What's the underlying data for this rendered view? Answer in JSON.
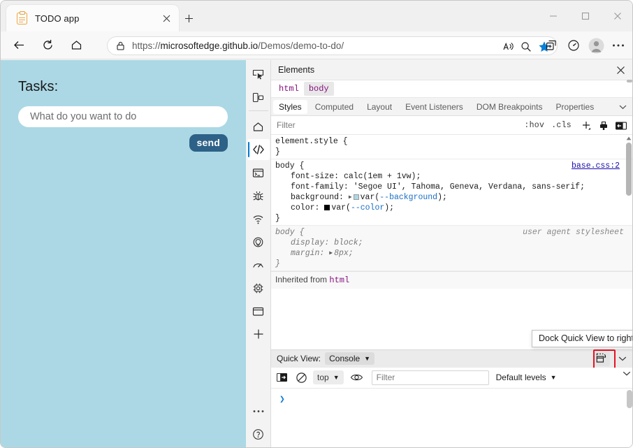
{
  "window": {
    "minimize_label": "Minimize",
    "maximize_label": "Maximize",
    "close_label": "Close"
  },
  "browser": {
    "tab": {
      "title": "TODO app",
      "favicon": "clipboard-icon",
      "close_label": "×"
    },
    "new_tab_label": "+",
    "nav": {
      "back": "back-arrow-icon",
      "refresh": "refresh-icon",
      "home": "home-icon"
    },
    "address": {
      "lock_icon": "lock-icon",
      "url_prefix": "https://",
      "url_host": "microsoftedge.github.io",
      "url_path": "/Demos/demo-to-do/",
      "url_full": "https://microsoftedge.github.io/Demos/demo-to-do/",
      "read_aloud_icon": "read-aloud-icon",
      "zoom_out_icon": "search-zoom-icon",
      "favorite_icon": "star-filled-icon"
    },
    "toolbar_right": [
      {
        "name": "collections-icon",
        "label": "Collections"
      },
      {
        "name": "performance-icon",
        "label": "Browser essentials"
      },
      {
        "name": "profile-avatar",
        "label": "Profile"
      },
      {
        "name": "settings-more-icon",
        "label": "Settings and more"
      }
    ]
  },
  "page": {
    "heading": "Tasks:",
    "input_placeholder": "What do you want to do",
    "input_value": "",
    "send_label": "send",
    "background_color": "#ACD8E5",
    "send_color": "#2e6187"
  },
  "devtools": {
    "rail": [
      {
        "name": "inspect-element-icon",
        "label": "Inspect"
      },
      {
        "name": "device-emulation-icon",
        "label": "Device emulation"
      },
      {
        "name": "welcome-home-icon",
        "label": "Welcome"
      },
      {
        "name": "elements-icon",
        "label": "Elements",
        "selected": true
      },
      {
        "name": "console-icon",
        "label": "Console"
      },
      {
        "name": "sources-debugger-icon",
        "label": "Sources"
      },
      {
        "name": "network-icon",
        "label": "Network"
      },
      {
        "name": "lighthouse-icon",
        "label": "Lighthouse"
      },
      {
        "name": "performance-gauge-icon",
        "label": "Performance"
      },
      {
        "name": "memory-chip-icon",
        "label": "Memory"
      },
      {
        "name": "application-window-icon",
        "label": "Application"
      },
      {
        "name": "more-tools-plus-icon",
        "label": "More tools"
      }
    ],
    "rail_bottom": [
      {
        "name": "more-options-icon",
        "label": "Customize and control DevTools"
      },
      {
        "name": "help-icon",
        "label": "Help"
      }
    ],
    "panel_title": "Elements",
    "panel_close_label": "×",
    "breadcrumb": [
      {
        "label": "html",
        "selected": false
      },
      {
        "label": "body",
        "selected": true
      }
    ],
    "styles_tabs": [
      {
        "label": "Styles",
        "selected": true
      },
      {
        "label": "Computed",
        "selected": false
      },
      {
        "label": "Layout",
        "selected": false
      },
      {
        "label": "Event Listeners",
        "selected": false
      },
      {
        "label": "DOM Breakpoints",
        "selected": false
      },
      {
        "label": "Properties",
        "selected": false
      }
    ],
    "styles_tabs_more_icon": "chevron-down-icon",
    "filter": {
      "placeholder": "Filter",
      "value": "",
      "hov_label": ":hov",
      "cls_label": ".cls",
      "new_rule_icon": "plus-icon",
      "element_state_icon": "print-style-icon",
      "sidebar_toggle_icon": "toggle-sidebar-icon"
    },
    "rules": [
      {
        "selector": "element.style {",
        "close": "}",
        "source": "",
        "declarations": []
      },
      {
        "selector": "body {",
        "close": "}",
        "source": "base.css:2",
        "declarations": [
          {
            "prop": "font-size",
            "value": "calc(1em + 1vw);"
          },
          {
            "prop": "font-family",
            "value": "'Segoe UI', Tahoma, Geneva, Verdana, sans-serif;"
          },
          {
            "prop": "background",
            "value": "var(--background);",
            "swatch": "#ACD8E5",
            "expandable": true
          },
          {
            "prop": "color",
            "value": "var(--color);",
            "swatch": "#000000",
            "expandable": false
          }
        ]
      },
      {
        "selector": "body {",
        "close": "}",
        "source": "user agent stylesheet",
        "user_agent": true,
        "declarations": [
          {
            "prop": "display",
            "value": "block;"
          },
          {
            "prop": "margin",
            "value": "8px;",
            "expandable": true
          }
        ]
      }
    ],
    "inherited_label": "Inherited from",
    "inherited_from": "html",
    "quick_view": {
      "label": "Quick View:",
      "selected": "Console",
      "dock_icon": "dock-quick-view-right-icon",
      "chevron_icon": "chevron-down-icon",
      "tooltip": "Dock Quick View to right",
      "highlight_color": "#e81123"
    },
    "console": {
      "sidebar_icon": "console-sidebar-icon",
      "clear_icon": "clear-console-icon",
      "context": "top",
      "eye_icon": "live-expression-icon",
      "filter_placeholder": "Filter",
      "filter_value": "",
      "levels": "Default levels",
      "prompt": "❯"
    }
  }
}
